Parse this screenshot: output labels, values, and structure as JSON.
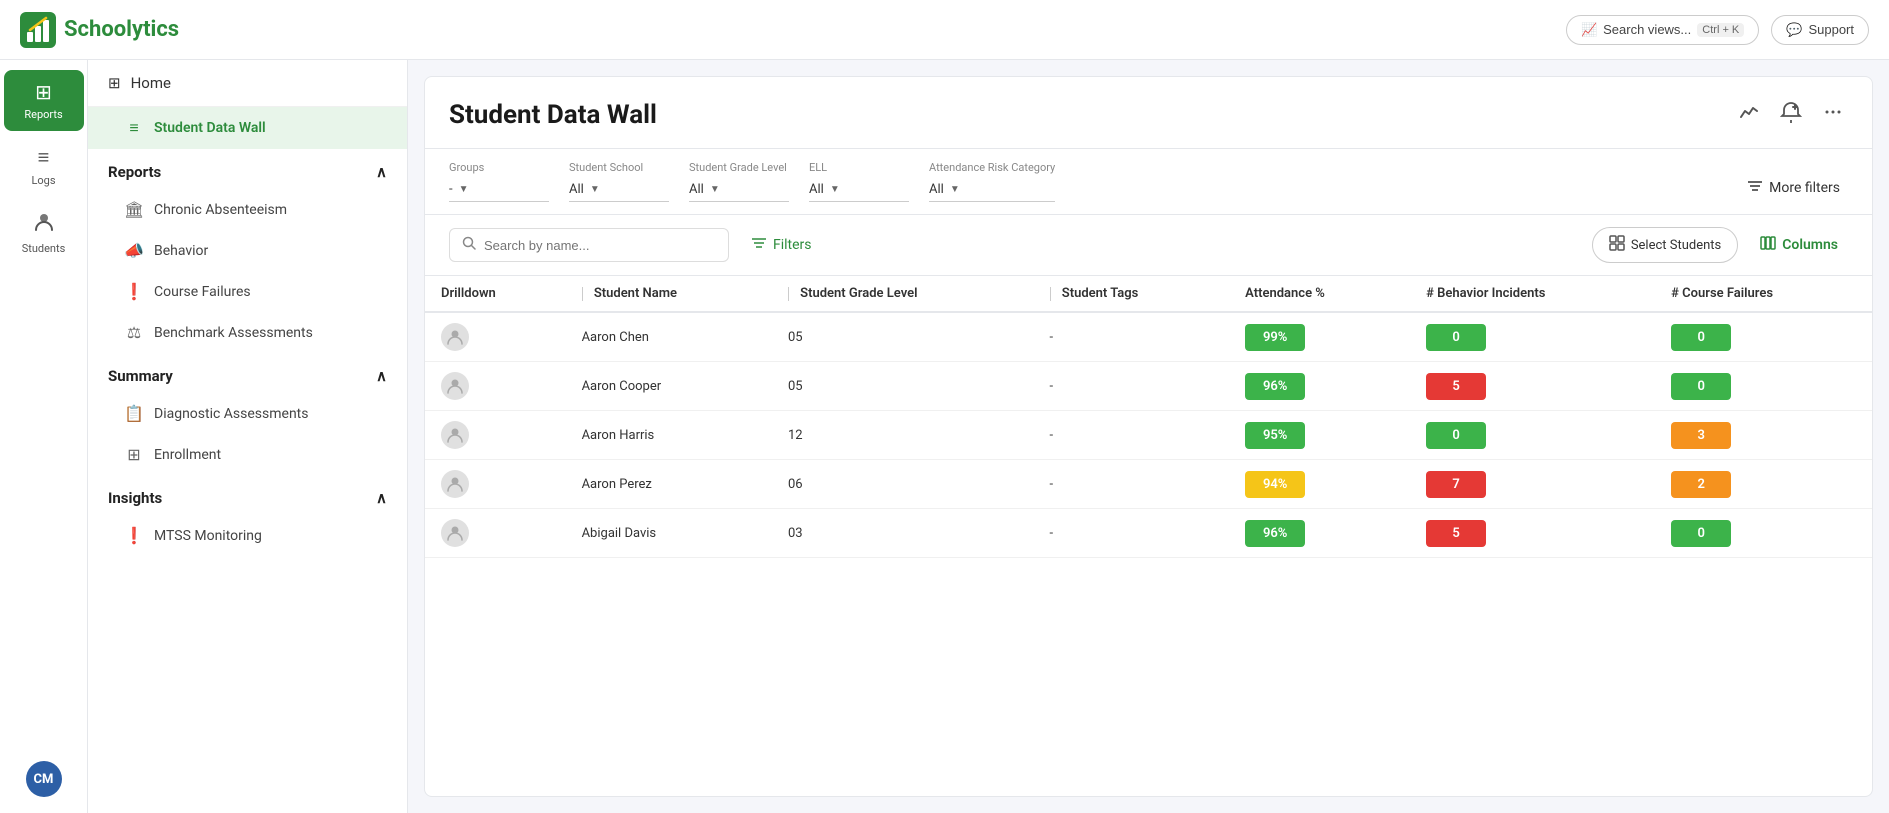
{
  "app": {
    "name": "Schoolytics",
    "logo_alt": "Schoolytics logo"
  },
  "header": {
    "search_views_label": "Search views...",
    "search_views_shortcut": "Ctrl + K",
    "support_label": "Support"
  },
  "icon_sidebar": {
    "items": [
      {
        "id": "reports",
        "label": "Reports",
        "icon": "⊞",
        "active": true
      },
      {
        "id": "logs",
        "label": "Logs",
        "icon": "≡",
        "active": false
      },
      {
        "id": "students",
        "label": "Students",
        "icon": "👤",
        "active": false
      }
    ],
    "user_initials": "CM"
  },
  "nav_sidebar": {
    "home_label": "Home",
    "sections": [
      {
        "id": "reports",
        "label": "Reports",
        "expanded": true,
        "items": [
          {
            "id": "chronic-absenteeism",
            "label": "Chronic Absenteeism",
            "icon": "🏛"
          },
          {
            "id": "behavior",
            "label": "Behavior",
            "icon": "📣"
          },
          {
            "id": "course-failures",
            "label": "Course Failures",
            "icon": "❗"
          },
          {
            "id": "benchmark-assessments",
            "label": "Benchmark Assessments",
            "icon": "⚖"
          }
        ]
      },
      {
        "id": "summary",
        "label": "Summary",
        "expanded": true,
        "items": [
          {
            "id": "diagnostic-assessments",
            "label": "Diagnostic Assessments",
            "icon": "📋"
          },
          {
            "id": "enrollment",
            "label": "Enrollment",
            "icon": "⊞"
          }
        ]
      },
      {
        "id": "insights",
        "label": "Insights",
        "expanded": true,
        "items": [
          {
            "id": "mtss-monitoring",
            "label": "MTSS Monitoring",
            "icon": "❗"
          }
        ]
      }
    ],
    "active_item": "student-data-wall"
  },
  "page": {
    "title": "Student Data Wall",
    "nav_label": "Student Data Wall"
  },
  "filters": {
    "groups_label": "Groups",
    "groups_value": "-",
    "student_school_label": "Student School",
    "student_school_value": "All",
    "student_grade_level_label": "Student Grade Level",
    "student_grade_level_value": "All",
    "ell_label": "ELL",
    "ell_value": "All",
    "attendance_risk_label": "Attendance Risk Category",
    "attendance_risk_value": "All",
    "more_filters_label": "More filters"
  },
  "action_bar": {
    "search_placeholder": "Search by name...",
    "filters_label": "Filters",
    "select_students_label": "Select Students",
    "columns_label": "Columns"
  },
  "table": {
    "columns": [
      {
        "id": "drilldown",
        "label": "Drilldown"
      },
      {
        "id": "student-name",
        "label": "Student Name"
      },
      {
        "id": "grade-level",
        "label": "Student Grade Level"
      },
      {
        "id": "student-tags",
        "label": "Student Tags"
      },
      {
        "id": "attendance",
        "label": "Attendance %"
      },
      {
        "id": "behavior-incidents",
        "label": "# Behavior Incidents"
      },
      {
        "id": "course-failures",
        "label": "# Course Failures"
      }
    ],
    "rows": [
      {
        "name": "Aaron Chen",
        "grade": "05",
        "tags": "-",
        "attendance": "99%",
        "attendance_color": "green",
        "behavior": "0",
        "behavior_color": "green",
        "course_failures": "0",
        "course_failures_color": "green"
      },
      {
        "name": "Aaron Cooper",
        "grade": "05",
        "tags": "-",
        "attendance": "96%",
        "attendance_color": "green",
        "behavior": "5",
        "behavior_color": "red",
        "course_failures": "0",
        "course_failures_color": "green"
      },
      {
        "name": "Aaron Harris",
        "grade": "12",
        "tags": "-",
        "attendance": "95%",
        "attendance_color": "green",
        "behavior": "0",
        "behavior_color": "green",
        "course_failures": "3",
        "course_failures_color": "orange"
      },
      {
        "name": "Aaron Perez",
        "grade": "06",
        "tags": "-",
        "attendance": "94%",
        "attendance_color": "yellow",
        "behavior": "7",
        "behavior_color": "red",
        "course_failures": "2",
        "course_failures_color": "orange"
      },
      {
        "name": "Abigail Davis",
        "grade": "03",
        "tags": "-",
        "attendance": "96%",
        "attendance_color": "green",
        "behavior": "5",
        "behavior_color": "red",
        "course_failures": "0",
        "course_failures_color": "green"
      }
    ]
  }
}
